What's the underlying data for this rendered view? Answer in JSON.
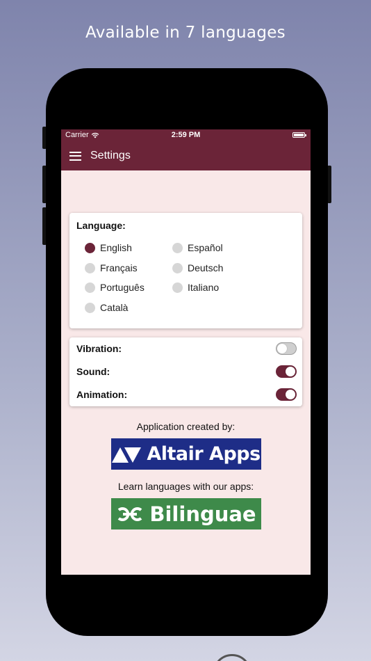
{
  "promo": {
    "headline": "Available in 7 languages"
  },
  "statusbar": {
    "carrier": "Carrier",
    "time": "2:59 PM"
  },
  "appbar": {
    "title": "Settings"
  },
  "language": {
    "label": "Language:",
    "options": [
      "English",
      "Español",
      "Français",
      "Deutsch",
      "Português",
      "Italiano",
      "Català"
    ],
    "selected": "English"
  },
  "toggles": [
    {
      "label": "Vibration:",
      "on": false
    },
    {
      "label": "Sound:",
      "on": true
    },
    {
      "label": "Animation:",
      "on": true
    }
  ],
  "credits": {
    "created_by": "Application created by:",
    "altair_brand": "Altair Apps",
    "learn": "Learn languages with our apps:",
    "bilinguae_brand": "Bilinguae"
  },
  "colors": {
    "primary": "#6b2438",
    "background": "#f9e8e8",
    "altair": "#1e2d87",
    "bilinguae": "#3e8a4a"
  }
}
